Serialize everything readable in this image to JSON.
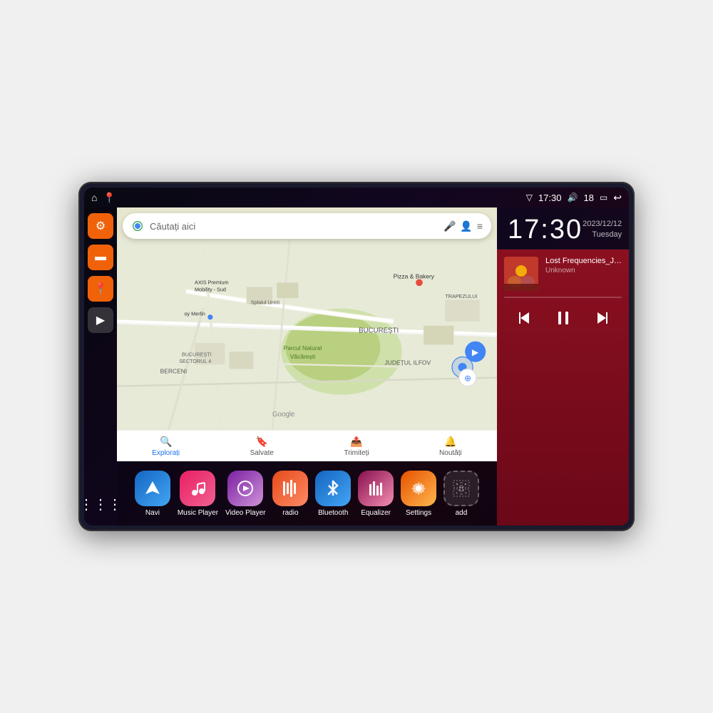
{
  "device": {
    "statusBar": {
      "leftIcons": [
        "⌂",
        "📍"
      ],
      "time": "17:30",
      "rightIcons": [
        "📶",
        "🔊",
        "18",
        "🔋",
        "↩"
      ]
    },
    "clock": {
      "time": "17:30",
      "date": "2023/12/12",
      "day": "Tuesday"
    },
    "music": {
      "title": "Lost Frequencies_Janie...",
      "artist": "Unknown",
      "albumArt": "concert"
    },
    "map": {
      "searchPlaceholder": "Căutați aici",
      "locations": [
        "AXIS Premium Mobility - Sud",
        "Pizza & Bakery",
        "Parcul Natural Văcărești",
        "BUCUREȘTI",
        "BUCUREȘTI SECTORUL 4",
        "BERCENI",
        "JUDEȚUL ILFOV",
        "TRAPEZULUI"
      ],
      "navItems": [
        "Explorați",
        "Salvate",
        "Trimiteți",
        "Noutăți"
      ]
    },
    "dock": {
      "apps": [
        {
          "id": "navi",
          "label": "Navi",
          "icon": "navi"
        },
        {
          "id": "music",
          "label": "Music Player",
          "icon": "music"
        },
        {
          "id": "video",
          "label": "Video Player",
          "icon": "video"
        },
        {
          "id": "radio",
          "label": "radio",
          "icon": "radio"
        },
        {
          "id": "bluetooth",
          "label": "Bluetooth",
          "icon": "bt"
        },
        {
          "id": "equalizer",
          "label": "Equalizer",
          "icon": "eq"
        },
        {
          "id": "settings",
          "label": "Settings",
          "icon": "settings"
        },
        {
          "id": "add",
          "label": "add",
          "icon": "add"
        }
      ]
    },
    "sidebar": {
      "items": [
        {
          "id": "settings",
          "icon": "⚙"
        },
        {
          "id": "files",
          "icon": "📁"
        },
        {
          "id": "map",
          "icon": "📍"
        },
        {
          "id": "navigation",
          "icon": "▶"
        }
      ]
    }
  }
}
